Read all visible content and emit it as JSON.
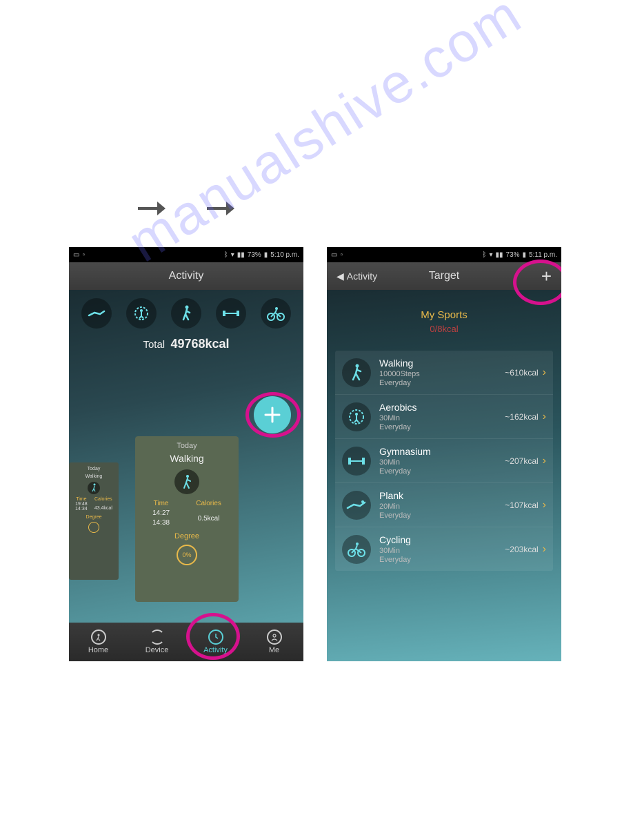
{
  "statusbar": {
    "battery_pct": "73%",
    "time_left": "5:10 p.m.",
    "time_right": "5:11 p.m."
  },
  "left_phone": {
    "title": "Activity",
    "total_label": "Total",
    "total_value": "49768kcal",
    "card_main": {
      "today": "Today",
      "activity_name": "Walking",
      "time_hdr": "Time",
      "cal_hdr": "Calories",
      "time1": "14:27",
      "time2": "14:38",
      "cal_val": "0.5kcal",
      "degree_label": "Degree",
      "degree_val": "0%"
    },
    "card_side": {
      "today": "Today",
      "activity_name": "Walking",
      "time_hdr": "Time",
      "cal_hdr": "Calories",
      "time1": "19:48",
      "time2": "14:34",
      "cal_val": "43.4kcal",
      "degree_label": "Degree"
    },
    "nav": {
      "home": "Home",
      "device": "Device",
      "activity": "Activity",
      "me": "Me"
    }
  },
  "right_phone": {
    "back_label": "Activity",
    "title": "Target",
    "heading": "My Sports",
    "subheading": "0/8kcal",
    "sports": [
      {
        "name": "Walking",
        "line2": "10000Steps",
        "freq": "Everyday",
        "kcal": "~610kcal"
      },
      {
        "name": "Aerobics",
        "line2": "30Min",
        "freq": "Everyday",
        "kcal": "~162kcal"
      },
      {
        "name": "Gymnasium",
        "line2": "30Min",
        "freq": "Everyday",
        "kcal": "~207kcal"
      },
      {
        "name": "Plank",
        "line2": "20Min",
        "freq": "Everyday",
        "kcal": "~107kcal"
      },
      {
        "name": "Cycling",
        "line2": "30Min",
        "freq": "Everyday",
        "kcal": "~203kcal"
      }
    ]
  },
  "watermark": "manualshive.com",
  "icons": {
    "plank": "⎽",
    "aerobics": "✦",
    "walk": "🚶",
    "dumbbell": "⊣⊢",
    "cycle": "🚴"
  }
}
